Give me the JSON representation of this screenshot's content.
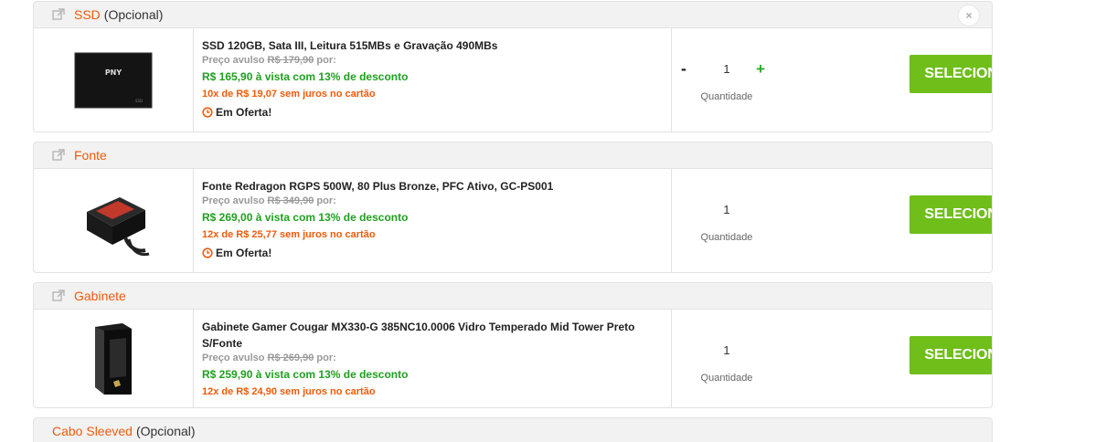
{
  "sections": [
    {
      "title": "SSD",
      "optional_label": "(Opcional)",
      "close_label": "×",
      "product": {
        "name": "SSD 120GB, Sata III, Leitura 515MBs e Gravação 490MBs",
        "old_price_prefix": "Preço avulso",
        "old_price": "R$ 179,90",
        "old_price_suffix": "por:",
        "cash_price": "R$ 165,90 à vista com 13% de desconto",
        "installments": "10x de R$ 19,07 sem juros no cartão",
        "offer_label": "Em Oferta!"
      },
      "quantity": {
        "minus": "-",
        "value": "1",
        "plus": "+",
        "label": "Quantidade"
      },
      "button_label": "SELECIONADO"
    },
    {
      "title": "Fonte",
      "product": {
        "name": "Fonte Redragon RGPS 500W, 80 Plus Bronze, PFC Ativo, GC-PS001",
        "old_price_prefix": "Preço avulso",
        "old_price": "R$ 349,90",
        "old_price_suffix": "por:",
        "cash_price": "R$ 269,00 à vista com 13% de desconto",
        "installments": "12x de R$ 25,77 sem juros no cartão",
        "offer_label": "Em Oferta!"
      },
      "quantity": {
        "value": "1",
        "label": "Quantidade"
      },
      "button_label": "SELECIONADO"
    },
    {
      "title": "Gabinete",
      "product": {
        "name": "Gabinete Gamer Cougar MX330-G 385NC10.0006 Vidro Temperado Mid Tower Preto S/Fonte",
        "old_price_prefix": "Preço avulso",
        "old_price": "R$ 269,90",
        "old_price_suffix": "por:",
        "cash_price": "R$ 259,90 à vista com 13% de desconto",
        "installments": "12x de R$ 24,90 sem juros no cartão"
      },
      "quantity": {
        "value": "1",
        "label": "Quantidade"
      },
      "button_label": "SELECIONADO"
    },
    {
      "title": "Cabo Sleeved",
      "optional_label": "(Opcional)"
    }
  ],
  "icons": {
    "section": "external-link-icon",
    "offer": "clock-icon",
    "button": "checkmark-icon"
  },
  "colors": {
    "section_title": "#f05a0a",
    "cash_price": "#1fa01f",
    "installments": "#f05a0a",
    "button": "#6fbe1a",
    "button_check": "#5aa50e",
    "plus": "#2ea82e"
  }
}
